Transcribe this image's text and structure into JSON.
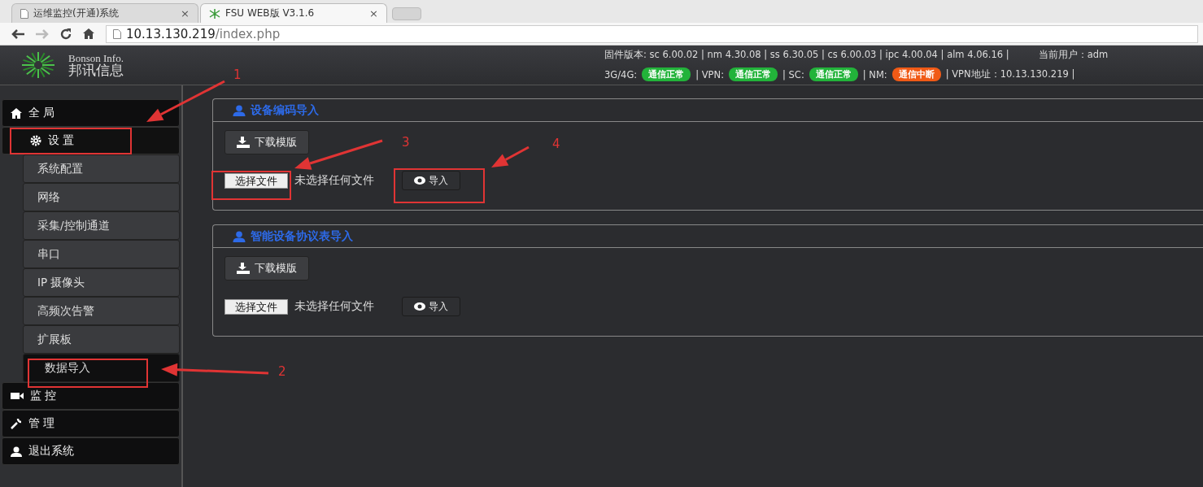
{
  "browser": {
    "tabs": [
      {
        "title": "运维监控(开通)系统",
        "selected": false,
        "close": "×"
      },
      {
        "title": "FSU WEB版 V3.1.6",
        "selected": true,
        "close": "×"
      }
    ],
    "address": {
      "host": "10.13.130.219",
      "path": "/index.php"
    }
  },
  "header": {
    "logo_en": "Bonson Info.",
    "logo_cn": "邦讯信息",
    "firmware": "固件版本: sc 6.00.02 | nm 4.30.08 | ss 6.30.05 | cs 6.00.03 | ipc 4.00.04 | alm 4.06.16 |",
    "user": "当前用户：adm",
    "statuses": [
      {
        "label": "3G/4G:",
        "badge": "通信正常",
        "color": "#22b33a"
      },
      {
        "label": "| VPN:",
        "badge": "通信正常",
        "color": "#22b33a"
      },
      {
        "label": "| SC:",
        "badge": "通信正常",
        "color": "#22b33a"
      },
      {
        "label": "| NM:",
        "badge": "通信中断",
        "color": "#f05a16"
      }
    ],
    "vpn_address": "| VPN地址：10.13.130.219 |"
  },
  "sidebar": {
    "items": [
      {
        "label": "全 局"
      },
      {
        "label": "设 置",
        "expanded": true,
        "children": [
          {
            "label": "系统配置",
            "selected": false
          },
          {
            "label": "网络",
            "selected": false
          },
          {
            "label": "采集/控制通道",
            "selected": false
          },
          {
            "label": "串口",
            "selected": false
          },
          {
            "label": "IP 摄像头",
            "selected": false
          },
          {
            "label": "高频次告警",
            "selected": false
          },
          {
            "label": "扩展板",
            "selected": false
          },
          {
            "label": "数据导入",
            "selected": true
          }
        ]
      },
      {
        "label": "监 控"
      },
      {
        "label": "管 理"
      },
      {
        "label": "退出系统"
      }
    ]
  },
  "panels": [
    {
      "title": "设备编码导入",
      "download": "下载模版",
      "choose": "选择文件",
      "no_file": "未选择任何文件",
      "import": "导入"
    },
    {
      "title": "智能设备协议表导入",
      "download": "下载模版",
      "choose": "选择文件",
      "no_file": "未选择任何文件",
      "import": "导入"
    }
  ],
  "annotations": [
    "1",
    "2",
    "3",
    "4"
  ]
}
